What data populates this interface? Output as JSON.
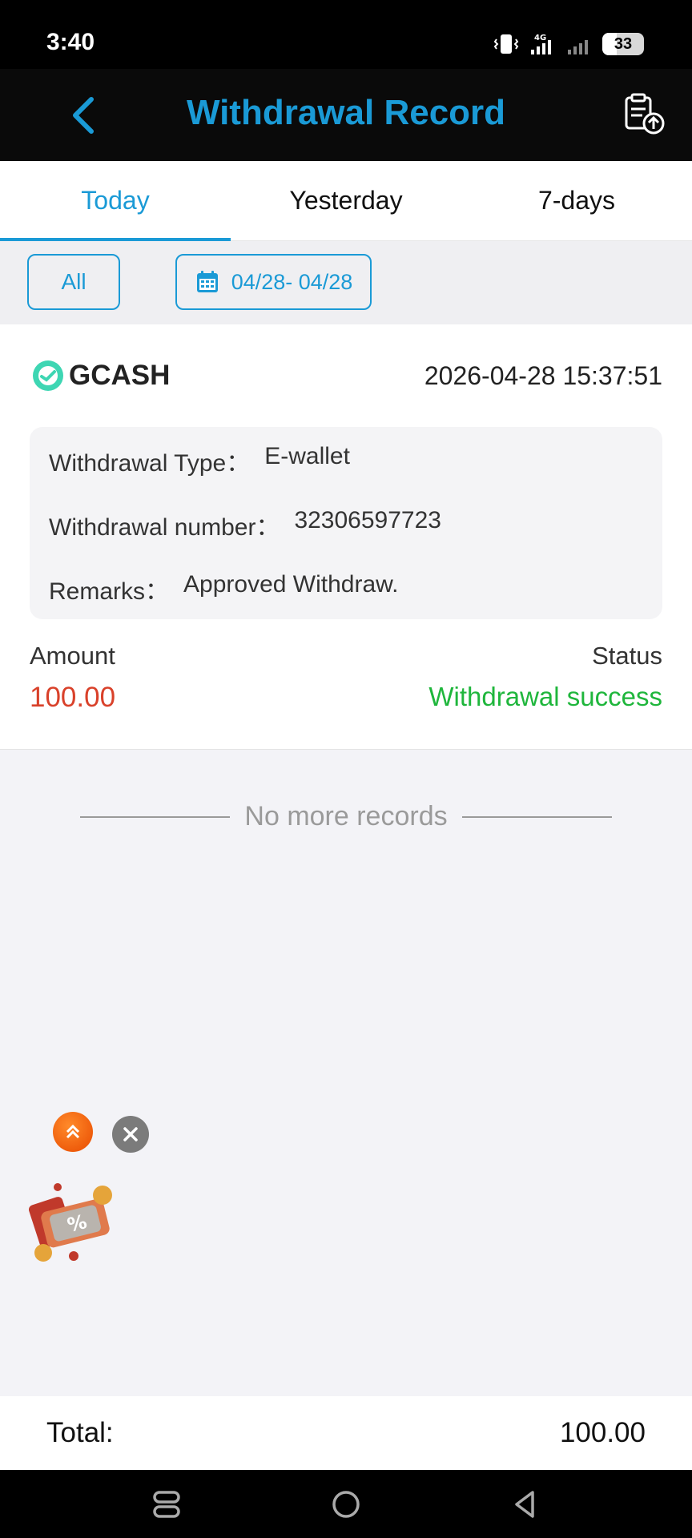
{
  "status_bar": {
    "time": "3:40",
    "network_label": "4G",
    "battery": "33"
  },
  "header": {
    "title": "Withdrawal Record",
    "back_icon": "chevron-left-icon",
    "action_icon": "clipboard-upload-icon"
  },
  "tabs": [
    {
      "label": "Today",
      "active": true
    },
    {
      "label": "Yesterday",
      "active": false
    },
    {
      "label": "7-days",
      "active": false
    }
  ],
  "filters": {
    "type_label": "All",
    "date_range": "04/28- 04/28",
    "date_icon": "calendar-icon"
  },
  "record": {
    "method": "GCASH",
    "datetime": "2026-04-28 15:37:51",
    "details": [
      {
        "label": "Withdrawal Type：",
        "value": "E-wallet"
      },
      {
        "label": "Withdrawal number：",
        "value": "32306597723"
      },
      {
        "label": "Remarks：",
        "value": "Approved Withdraw."
      }
    ],
    "amount_label": "Amount",
    "amount_value": "100.00",
    "status_label": "Status",
    "status_value": "Withdrawal success"
  },
  "list_end_text": "No more records",
  "total": {
    "label": "Total:",
    "value": "100.00"
  },
  "colors": {
    "accent": "#1a9ad6",
    "amount": "#d9412a",
    "success": "#1fb63c"
  }
}
